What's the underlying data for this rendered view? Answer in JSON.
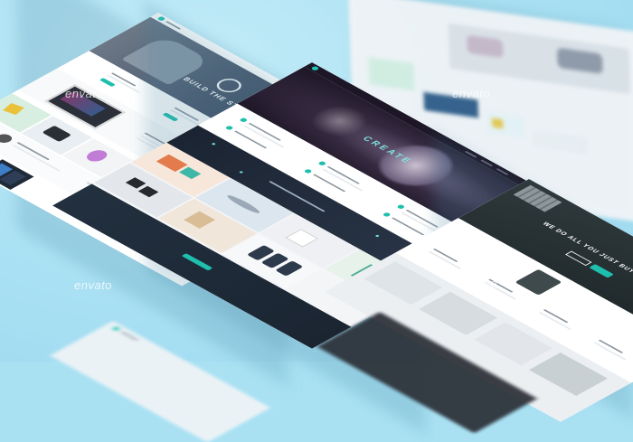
{
  "watermark": "envato",
  "left_page": {
    "hero_title": "BUILD THE STARTUP"
  },
  "mid_page": {
    "hero_title": "CREATE"
  },
  "right_page": {
    "hero_title": "WE DO ALL YOU JUST BUY AND ENJOY"
  },
  "colors": {
    "background": "#a9e1f3",
    "accent": "#1fbfae",
    "dark_panel": "#1e2a3a",
    "hero_purple": "#2a1e3c"
  }
}
